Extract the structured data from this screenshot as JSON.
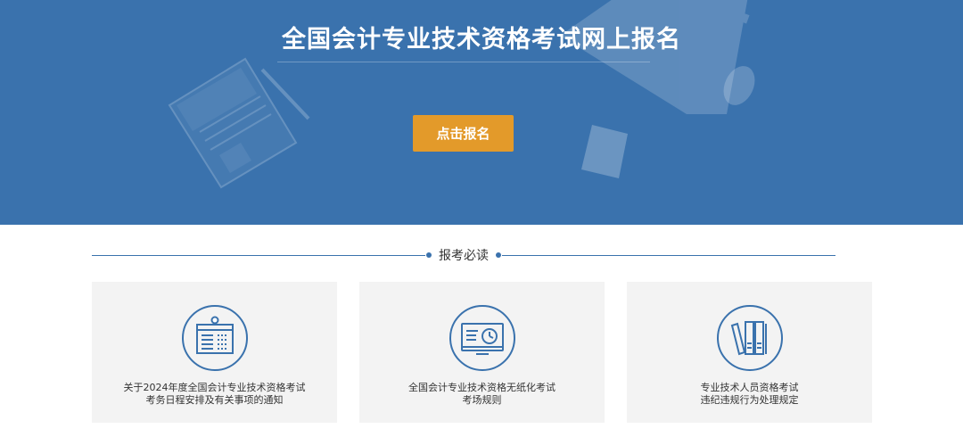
{
  "banner": {
    "title": "全国会计专业技术资格考试网上报名",
    "register_button": "点击报名",
    "background_color": "#3a72ad",
    "button_color": "#e39a2a"
  },
  "section": {
    "heading": "报考必读"
  },
  "cards": [
    {
      "icon": "calendar-notice-icon",
      "line1": "关于2024年度全国会计专业技术资格考试",
      "line2": "考务日程安排及有关事项的通知"
    },
    {
      "icon": "monitor-clock-icon",
      "line1": "全国会计专业技术资格无纸化考试",
      "line2": "考场规则"
    },
    {
      "icon": "books-icon",
      "line1": "专业技术人员资格考试",
      "line2": "违纪违规行为处理规定"
    }
  ]
}
